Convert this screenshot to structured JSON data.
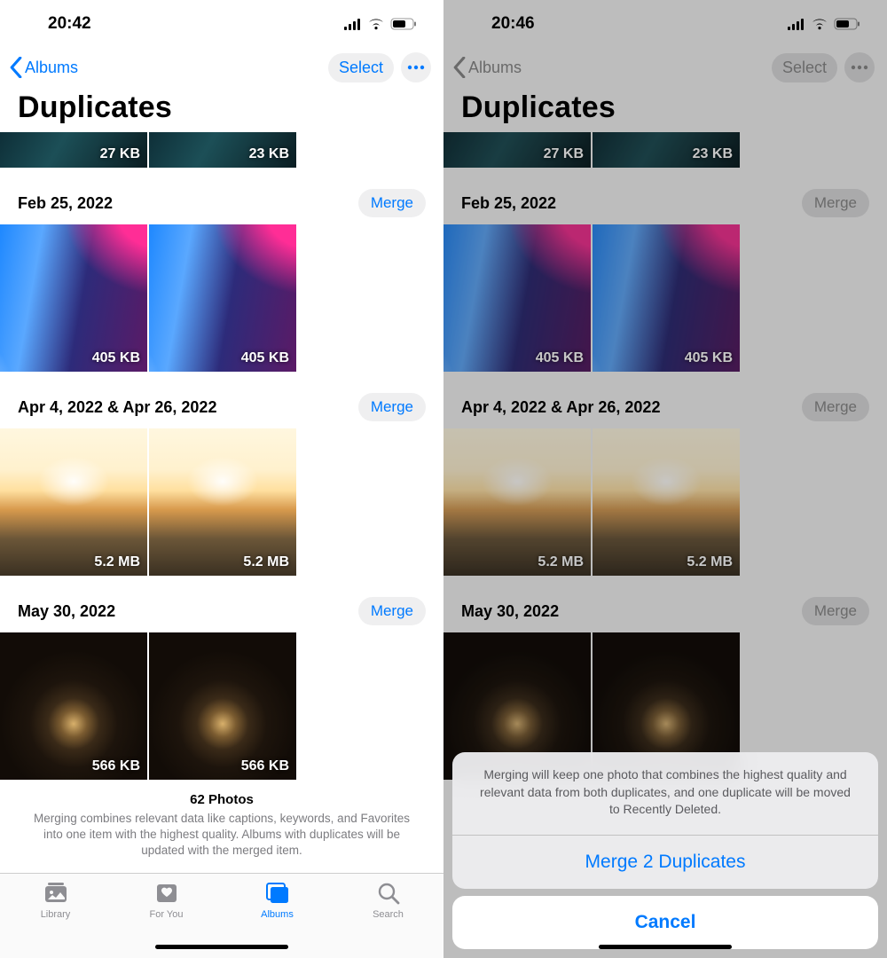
{
  "left": {
    "status": {
      "time": "20:42"
    },
    "nav": {
      "back": "Albums",
      "select": "Select"
    },
    "title": "Duplicates",
    "cut_sizes": [
      "27 KB",
      "23 KB"
    ],
    "groups": [
      {
        "date": "Feb 25, 2022",
        "merge": "Merge",
        "sizes": [
          "405 KB",
          "405 KB"
        ]
      },
      {
        "date": "Apr 4, 2022 & Apr 26, 2022",
        "merge": "Merge",
        "sizes": [
          "5.2 MB",
          "5.2 MB"
        ]
      },
      {
        "date": "May 30, 2022",
        "merge": "Merge",
        "sizes": [
          "566 KB",
          "566 KB"
        ]
      }
    ],
    "footer": {
      "count": "62 Photos",
      "desc": "Merging combines relevant data like captions, keywords, and Favorites into one item with the highest quality. Albums with duplicates will be updated with the merged item."
    },
    "tabs": {
      "library": "Library",
      "foryou": "For You",
      "albums": "Albums",
      "search": "Search"
    }
  },
  "right": {
    "status": {
      "time": "20:46"
    },
    "nav": {
      "back": "Albums",
      "select": "Select"
    },
    "title": "Duplicates",
    "cut_sizes": [
      "27 KB",
      "23 KB"
    ],
    "groups": [
      {
        "date": "Feb 25, 2022",
        "merge": "Merge",
        "sizes": [
          "405 KB",
          "405 KB"
        ]
      },
      {
        "date": "Apr 4, 2022 & Apr 26, 2022",
        "merge": "Merge",
        "sizes": [
          "5.2 MB",
          "5.2 MB"
        ]
      },
      {
        "date": "May 30, 2022",
        "merge": "Merge"
      }
    ],
    "sheet": {
      "message": "Merging will keep one photo that combines the highest quality and relevant data from both duplicates, and one duplicate will be moved to Recently Deleted.",
      "action": "Merge 2 Duplicates",
      "cancel": "Cancel"
    }
  }
}
